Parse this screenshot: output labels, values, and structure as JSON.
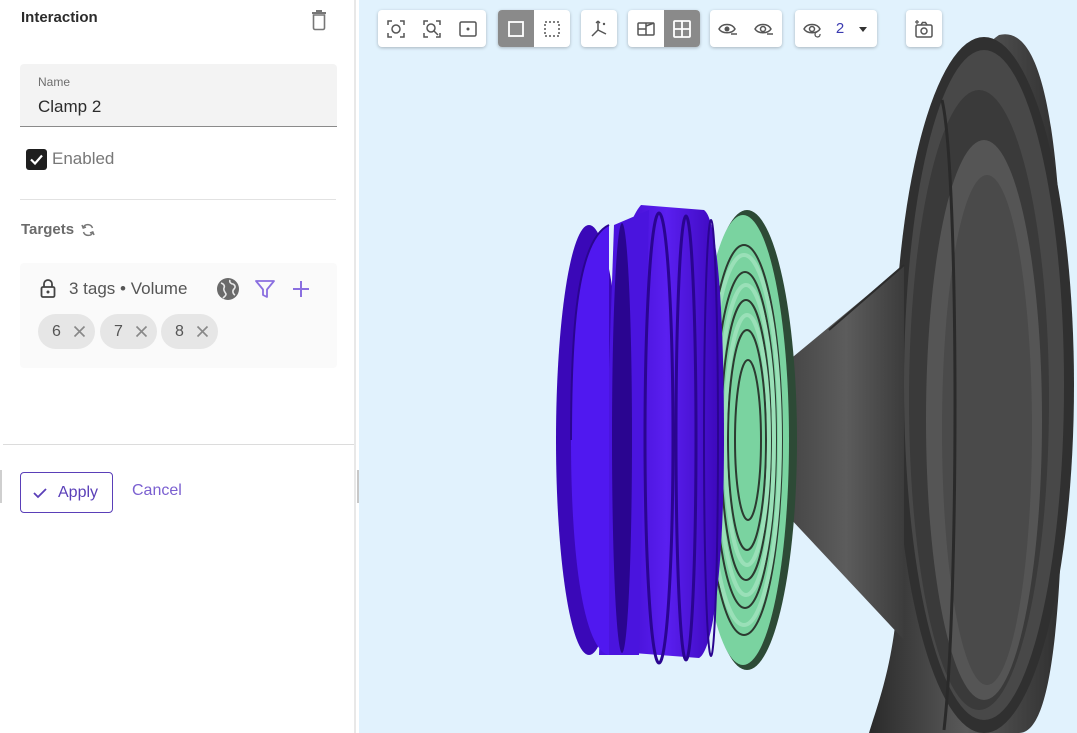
{
  "panel": {
    "title": "Interaction",
    "name_field": {
      "label": "Name",
      "value": "Clamp 2"
    },
    "enabled": {
      "label": "Enabled",
      "checked": true
    },
    "targets": {
      "title": "Targets",
      "summary": "3 tags • Volume",
      "chips": [
        "6",
        "7",
        "8"
      ]
    },
    "apply_label": "Apply",
    "cancel_label": "Cancel"
  },
  "viewport": {
    "background": "#e1f2fd",
    "toolbar": {
      "groups": [
        {
          "buttons": [
            "zoom-to-fit-icon",
            "zoom-to-region-icon",
            "frame-selection-icon"
          ]
        },
        {
          "buttons": [
            "select-single-icon",
            "select-box-icon"
          ],
          "active": "select-single-icon"
        },
        {
          "buttons": [
            "axes-triad-icon"
          ]
        },
        {
          "buttons": [
            "section-view-icon",
            "grid-view-icon"
          ],
          "active": "grid-view-icon"
        },
        {
          "buttons": [
            "hide-icon",
            "show-icon"
          ]
        },
        {
          "buttons": [
            "visibility-icon"
          ]
        },
        {
          "buttons": [
            "screenshot-icon"
          ]
        }
      ],
      "visibility_count": "2"
    },
    "parts": [
      {
        "name": "volume-part",
        "color": "#4a0fd6"
      },
      {
        "name": "spider-part",
        "color": "#7bd3a2"
      },
      {
        "name": "cone-part",
        "color": "#4a4a4a"
      }
    ]
  },
  "colors": {
    "accent": "#5a3fb8",
    "accent_light": "#8a6fe0",
    "active_button": "#8a8a8a"
  }
}
